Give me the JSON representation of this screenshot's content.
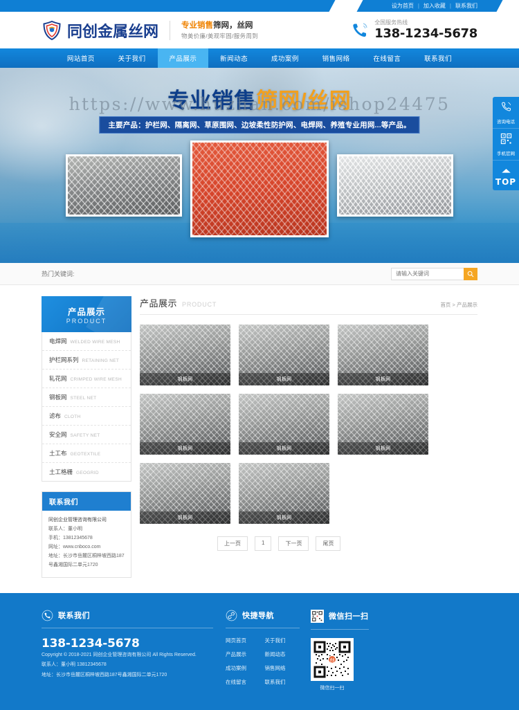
{
  "topbar": {
    "links": [
      "设为首页",
      "加入收藏",
      "联系我们"
    ],
    "separator": "|"
  },
  "header": {
    "logo_text": "同创金属丝网",
    "logo_icon": "shield-logo-icon",
    "slogan_main_prefix": "专业销售",
    "slogan_main_rest": "筛网，丝网",
    "slogan_sub": "物美价廉/美观牢固/服务周到",
    "tel_icon": "phone-icon",
    "tel_label": "全国服务热线",
    "tel_number": "138-1234-5678"
  },
  "nav": {
    "items": [
      {
        "label": "网站首页",
        "active": false
      },
      {
        "label": "关于我们",
        "active": false
      },
      {
        "label": "产品展示",
        "active": true
      },
      {
        "label": "新闻动态",
        "active": false
      },
      {
        "label": "成功案例",
        "active": false
      },
      {
        "label": "销售网络",
        "active": false
      },
      {
        "label": "在线留言",
        "active": false
      },
      {
        "label": "联系我们",
        "active": false
      }
    ]
  },
  "banner": {
    "title_blue": "专业销售",
    "title_orange": "筛网/丝网",
    "watermark": "https://www.huzhan.com/ishop24475",
    "subtitle": "主要产品：护栏网、隔离网、草原围网、边坡柔性防护网、电焊网、养殖专业用网...等产品。",
    "images": [
      {
        "alt": "镀锌钢板网卷",
        "style": "gray"
      },
      {
        "alt": "红色钢板网",
        "style": "red"
      },
      {
        "alt": "银色菱形钢板网",
        "style": "silver"
      }
    ]
  },
  "side_widget": {
    "items": [
      {
        "icon": "phone-ring-icon",
        "label": "咨询电话"
      },
      {
        "icon": "qr-code-icon",
        "label": "手机官网"
      },
      {
        "icon": "arrow-up-icon",
        "label": "TOP"
      }
    ]
  },
  "search": {
    "hot_label": "热门关键词:",
    "placeholder": "请输入关键词",
    "value": "",
    "button_icon": "search-icon"
  },
  "sidebar": {
    "category_head_cn": "产品展示",
    "category_head_en": "PRODUCT",
    "categories": [
      {
        "cn": "电焊网",
        "en": "WELDED WIRE MESH"
      },
      {
        "cn": "护栏网系列",
        "en": "RETAINING NET"
      },
      {
        "cn": "轧花网",
        "en": "CRIMPED WIRE MESH"
      },
      {
        "cn": "钢板网",
        "en": "STEEL NET"
      },
      {
        "cn": "滤布",
        "en": "CLOTH"
      },
      {
        "cn": "安全网",
        "en": "SAFETY NET"
      },
      {
        "cn": "土工布",
        "en": "GEOTEXTILE"
      },
      {
        "cn": "土工格栅",
        "en": "GEOGRID"
      }
    ],
    "contact_title": "联系我们",
    "contact_lines": [
      "同创企业管理咨询有限公司",
      "联系人：董小明",
      "手机：13812345678",
      "网址：www.cnboco.com",
      "地址：长沙市岳麓区桐梓坡西路187",
      "号鑫湘国际二单元1720"
    ]
  },
  "content": {
    "title_cn": "产品展示",
    "title_en": "PRODUCT",
    "breadcrumb": "首页 > 产品展示",
    "products": [
      {
        "caption": "钢板网"
      },
      {
        "caption": "钢板网"
      },
      {
        "caption": "钢板网"
      },
      {
        "caption": "钢板网"
      },
      {
        "caption": "钢板网"
      },
      {
        "caption": "钢板网"
      },
      {
        "caption": "钢板网"
      },
      {
        "caption": "钢板网"
      }
    ],
    "pagination": [
      "上一页",
      "1",
      "下一页",
      "尾页"
    ]
  },
  "footer": {
    "contact_icon": "phone-circle-icon",
    "contact_title": "联系我们",
    "tel": "138-1234-5678",
    "copyright": "Copyright © 2018-2021 同创企业管理咨询有限公司 All Rights Reserved.",
    "contact_person": "联系人：董小明 13812345678",
    "address": "地址：长沙市岳麓区桐梓坡西路187号鑫湘国际二单元1720",
    "nav_icon": "link-circle-icon",
    "nav_title": "快捷导航",
    "nav_links": [
      "网页首页",
      "关于我们",
      "产品展示",
      "新闻动态",
      "成功案例",
      "销售网络",
      "在线留言",
      "联系我们"
    ],
    "qr_icon": "qr-small-icon",
    "qr_title": "微信扫一扫",
    "qr_caption": "微信扫一扫"
  },
  "colors": {
    "brand_blue": "#1287dd",
    "deep_blue": "#0d6fc0",
    "accent_orange": "#f2a01e",
    "nav_active": "#49b5f2",
    "footer_blue": "#1279c9"
  }
}
